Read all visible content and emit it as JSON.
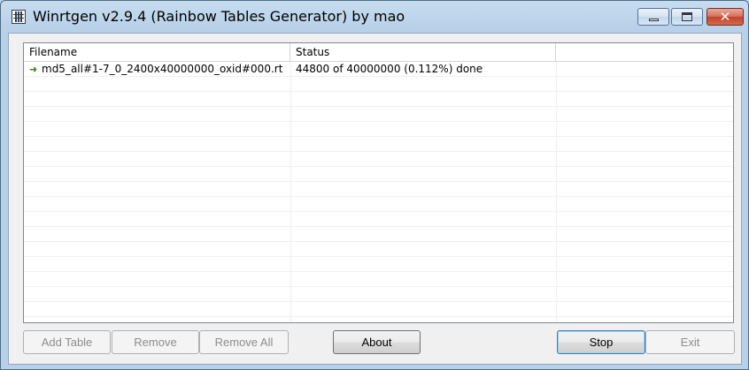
{
  "window": {
    "title": "Winrtgen v2.9.4 (Rainbow Tables Generator) by mao"
  },
  "table": {
    "columns": [
      "Filename",
      "Status",
      ""
    ],
    "rows": [
      {
        "filename": "md5_all#1-7_0_2400x40000000_oxid#000.rt",
        "status": "44800 of 40000000 (0.112%) done",
        "icon": "arrow-icon"
      }
    ]
  },
  "buttons": {
    "add_table": "Add Table",
    "remove": "Remove",
    "remove_all": "Remove All",
    "about": "About",
    "stop": "Stop",
    "exit": "Exit"
  }
}
